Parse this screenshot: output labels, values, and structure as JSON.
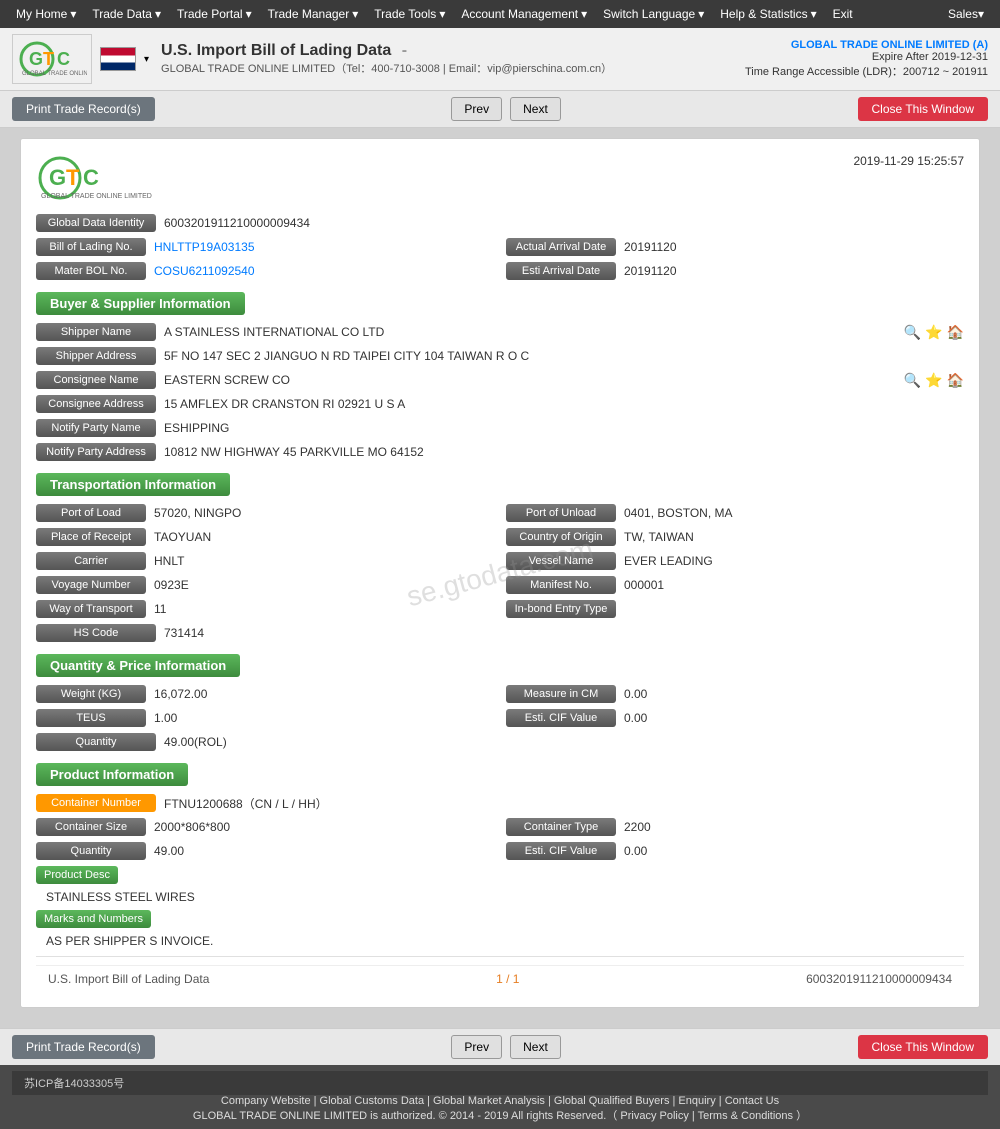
{
  "nav": {
    "items": [
      {
        "label": "My Home",
        "hasArrow": true
      },
      {
        "label": "Trade Data",
        "hasArrow": true
      },
      {
        "label": "Trade Portal",
        "hasArrow": true
      },
      {
        "label": "Trade Manager",
        "hasArrow": true
      },
      {
        "label": "Trade Tools",
        "hasArrow": true
      },
      {
        "label": "Account Management",
        "hasArrow": true
      },
      {
        "label": "Switch Language",
        "hasArrow": true
      },
      {
        "label": "Help & Statistics",
        "hasArrow": true
      },
      {
        "label": "Exit",
        "hasArrow": false
      }
    ],
    "sales_label": "Sales"
  },
  "header": {
    "title": "U.S. Import Bill of Lading Data",
    "dash": "-",
    "company_line": "GLOBAL TRADE ONLINE LIMITED（Tel：400-710-3008 | Email：vip@pierschina.com.cn）",
    "top_right_company": "GLOBAL TRADE ONLINE LIMITED (A)",
    "expire": "Expire After 2019-12-31",
    "ldr": "Time Range Accessible (LDR)：200712 ~ 201911"
  },
  "toolbar": {
    "print_label": "Print Trade Record(s)",
    "prev_label": "Prev",
    "next_label": "Next",
    "close_label": "Close This Window"
  },
  "card": {
    "timestamp": "2019-11-29 15:25:57",
    "global_data_id_label": "Global Data Identity",
    "global_data_id_value": "6003201911210000009434",
    "bol_no_label": "Bill of Lading No.",
    "bol_no_value": "HNLTTP19A03135",
    "actual_arrival_label": "Actual Arrival Date",
    "actual_arrival_value": "20191120",
    "master_bol_label": "Mater BOL No.",
    "master_bol_value": "COSU6211092540",
    "esti_arrival_label": "Esti Arrival Date",
    "esti_arrival_value": "20191120"
  },
  "buyer_supplier": {
    "section_title": "Buyer & Supplier Information",
    "shipper_name_label": "Shipper Name",
    "shipper_name_value": "A STAINLESS INTERNATIONAL CO LTD",
    "shipper_address_label": "Shipper Address",
    "shipper_address_value": "5F NO 147 SEC 2 JIANGUO N RD TAIPEI CITY 104 TAIWAN R O C",
    "consignee_name_label": "Consignee Name",
    "consignee_name_value": "EASTERN SCREW CO",
    "consignee_address_label": "Consignee Address",
    "consignee_address_value": "15 AMFLEX DR CRANSTON RI 02921 U S A",
    "notify_party_name_label": "Notify Party Name",
    "notify_party_name_value": "ESHIPPING",
    "notify_party_address_label": "Notify Party Address",
    "notify_party_address_value": "10812 NW HIGHWAY 45 PARKVILLE MO 64152"
  },
  "transportation": {
    "section_title": "Transportation Information",
    "port_of_load_label": "Port of Load",
    "port_of_load_value": "57020, NINGPO",
    "port_of_unload_label": "Port of Unload",
    "port_of_unload_value": "0401, BOSTON, MA",
    "place_of_receipt_label": "Place of Receipt",
    "place_of_receipt_value": "TAOYUAN",
    "country_of_origin_label": "Country of Origin",
    "country_of_origin_value": "TW, TAIWAN",
    "carrier_label": "Carrier",
    "carrier_value": "HNLT",
    "vessel_name_label": "Vessel Name",
    "vessel_name_value": "EVER LEADING",
    "voyage_label": "Voyage Number",
    "voyage_value": "0923E",
    "manifest_label": "Manifest No.",
    "manifest_value": "000001",
    "way_of_transport_label": "Way of Transport",
    "way_of_transport_value": "11",
    "inbond_label": "In-bond Entry Type",
    "inbond_value": "",
    "hs_code_label": "HS Code",
    "hs_code_value": "731414"
  },
  "quantity_price": {
    "section_title": "Quantity & Price Information",
    "weight_label": "Weight (KG)",
    "weight_value": "16,072.00",
    "measure_label": "Measure in CM",
    "measure_value": "0.00",
    "teus_label": "TEUS",
    "teus_value": "1.00",
    "esti_cif_label": "Esti. CIF Value",
    "esti_cif_value": "0.00",
    "quantity_label": "Quantity",
    "quantity_value": "49.00(ROL)"
  },
  "product": {
    "section_title": "Product Information",
    "container_num_label": "Container Number",
    "container_num_value": "FTNU1200688（CN / L / HH）",
    "container_size_label": "Container Size",
    "container_size_value": "2000*806*800",
    "container_type_label": "Container Type",
    "container_type_value": "2200",
    "quantity_label": "Quantity",
    "quantity_value": "49.00",
    "esti_cif_label": "Esti. CIF Value",
    "esti_cif_value": "0.00",
    "product_desc_label": "Product Desc",
    "product_desc_value": "STAINLESS STEEL WIRES",
    "marks_label": "Marks and Numbers",
    "marks_value": "AS PER SHIPPER S INVOICE."
  },
  "footer_bar": {
    "left_text": "U.S. Import Bill of Lading Data",
    "pagination": "1 / 1",
    "record_id": "6003201911210000009434"
  },
  "site_footer": {
    "icp": "苏ICP备14033305号",
    "links": "Company Website | Global Customs Data | Global Market Analysis | Global Qualified Buyers | Enquiry | Contact Us",
    "copyright": "GLOBAL TRADE ONLINE LIMITED is authorized. © 2014 - 2019 All rights Reserved.（ Privacy Policy | Terms & Conditions ）"
  },
  "watermark": "se.gtodata.com"
}
